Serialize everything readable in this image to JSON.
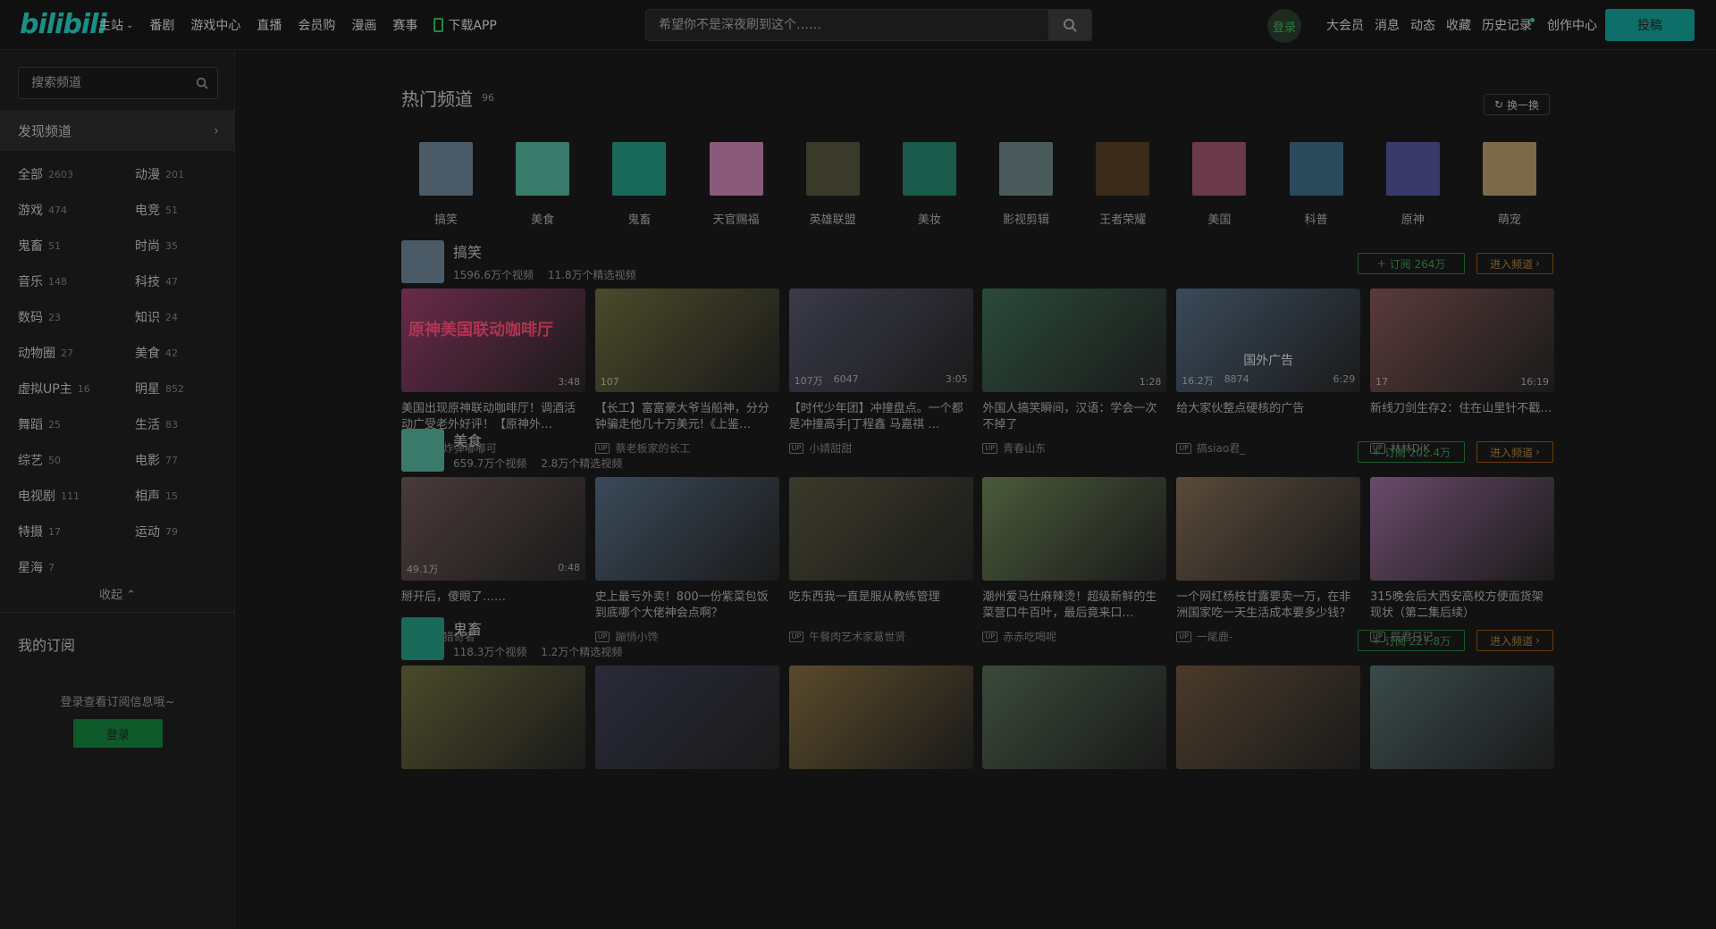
{
  "header": {
    "logo": "bilibili",
    "nav": [
      {
        "label": "主站",
        "chevron": true
      },
      {
        "label": "番剧"
      },
      {
        "label": "游戏中心"
      },
      {
        "label": "直播"
      },
      {
        "label": "会员购"
      },
      {
        "label": "漫画"
      },
      {
        "label": "赛事"
      },
      {
        "label": "下载APP",
        "icon": "phone-icon"
      }
    ],
    "search_placeholder": "希望你不是深夜刷到这个……",
    "login": "登录",
    "right_links": [
      "大会员",
      "消息",
      "动态",
      "收藏",
      "历史记录",
      "创作中心"
    ],
    "upload": "投稿"
  },
  "sidebar": {
    "search_placeholder": "搜索频道",
    "discover": "发现频道",
    "categories": [
      {
        "name": "全部",
        "count": "2603"
      },
      {
        "name": "动漫",
        "count": "201"
      },
      {
        "name": "游戏",
        "count": "474"
      },
      {
        "name": "电竞",
        "count": "51"
      },
      {
        "name": "鬼畜",
        "count": "51"
      },
      {
        "name": "时尚",
        "count": "35"
      },
      {
        "name": "音乐",
        "count": "148"
      },
      {
        "name": "科技",
        "count": "47"
      },
      {
        "name": "数码",
        "count": "23"
      },
      {
        "name": "知识",
        "count": "24"
      },
      {
        "name": "动物圈",
        "count": "27"
      },
      {
        "name": "美食",
        "count": "42"
      },
      {
        "name": "虚拟UP主",
        "count": "16"
      },
      {
        "name": "明星",
        "count": "852"
      },
      {
        "name": "舞蹈",
        "count": "25"
      },
      {
        "name": "生活",
        "count": "83"
      },
      {
        "name": "综艺",
        "count": "50"
      },
      {
        "name": "电影",
        "count": "77"
      },
      {
        "name": "电视剧",
        "count": "111"
      },
      {
        "name": "相声",
        "count": "15"
      },
      {
        "name": "特摄",
        "count": "17"
      },
      {
        "name": "运动",
        "count": "79"
      },
      {
        "name": "星海",
        "count": "7"
      }
    ],
    "collapse": "收起",
    "my_subscriptions": "我的订阅",
    "login_tip": "登录查看订阅信息哦~",
    "login_button": "登录"
  },
  "hot": {
    "title": "热门频道",
    "count": "96",
    "swap": "换一换",
    "channels": [
      {
        "label": "搞笑",
        "color": "#4a5a66"
      },
      {
        "label": "美食",
        "color": "#3a7a6a"
      },
      {
        "label": "鬼畜",
        "color": "#1a6a5a"
      },
      {
        "label": "天官赐福",
        "color": "#8a5a7a"
      },
      {
        "label": "英雄联盟",
        "color": "#3a3a2a"
      },
      {
        "label": "美妆",
        "color": "#1a5a4a"
      },
      {
        "label": "影视剪辑",
        "color": "#4a5a5a"
      },
      {
        "label": "王者荣耀",
        "color": "#3a2a1a"
      },
      {
        "label": "美国",
        "color": "#6a3a4a"
      },
      {
        "label": "科普",
        "color": "#2a4a5a"
      },
      {
        "label": "原神",
        "color": "#3a3a6a"
      },
      {
        "label": "萌宠",
        "color": "#7a6a4a"
      }
    ]
  },
  "sections": [
    {
      "name": "搞笑",
      "avatar_color": "#4a5a66",
      "videos_count": "1596.6万个视频",
      "featured_count": "11.8万个精选视频",
      "subscribe": "订阅 264万",
      "enter": "进入频道",
      "cards": [
        {
          "title": "美国出现原神联动咖啡厅！调酒活动广受老外好评！【原神外…",
          "up": "蹦蹦炸弹嘟嘟可",
          "color": "#6a2a4a",
          "overlay": "原神美国联动咖啡厅",
          "play": "",
          "like": "",
          "dur": "3:48"
        },
        {
          "title": "【长工】富富豪大爷当船神，分分钟骗走他几十万美元!《上鉴…",
          "up": "蔡老板家的长工",
          "color": "#4a4a2a",
          "overlay": "",
          "play": "107",
          "like": "",
          "dur": ""
        },
        {
          "title": "【时代少年团】冲撞盘点。一个都是冲撞高手|丁程鑫 马嘉祺 …",
          "up": "小婧甜甜",
          "color": "#3a3a4a",
          "overlay": "",
          "play": "107万",
          "like": "6047",
          "dur": "3:05"
        },
        {
          "title": "外国人搞笑瞬间，汉语：学会一次不掉了",
          "up": "青春山东",
          "color": "#2a4a3a",
          "overlay": "",
          "play": "",
          "like": "",
          "dur": "1:28"
        },
        {
          "title": "给大家伙整点硬核的广告",
          "up": "搞siao君_",
          "color": "#3a4a5a",
          "overlay": "",
          "overlay2": "国外广告",
          "play": "16.2万",
          "like": "8874",
          "dur": "6:29"
        },
        {
          "title": "新线刀剑生存2：住在山里针不戳…",
          "up": "林林DjK",
          "color": "#5a3a3a",
          "overlay": "",
          "play": "17",
          "like": "",
          "dur": "16:19"
        }
      ]
    },
    {
      "name": "美食",
      "avatar_color": "#3a7a6a",
      "videos_count": "659.7万个视频",
      "featured_count": "2.8万个精选视频",
      "subscribe": "订阅 202.4万",
      "enter": "进入频道",
      "cards": [
        {
          "title": "掰开后，傻眼了……",
          "up": "美好猎奇者",
          "color": "#4a3a3a",
          "overlay": "",
          "play": "49.1万",
          "like": "",
          "dur": "0:48"
        },
        {
          "title": "史上最亏外卖！800一份紫菜包饭到底哪个大佬神会点啊？",
          "up": "蹦悄小馋",
          "color": "#3a4a5a",
          "overlay": "",
          "play": "",
          "like": "",
          "dur": ""
        },
        {
          "title": "吃东西我一直是服从教练管理",
          "up": "午餐肉艺术家葛世贤",
          "color": "#3a3a2a",
          "overlay": "",
          "play": "",
          "like": "",
          "dur": ""
        },
        {
          "title": "潮州爱马仕麻辣烫！超级新鲜的生菜营口牛百叶，最后竟来口…",
          "up": "赤赤吃喝呢",
          "color": "#4a5a3a",
          "overlay": "",
          "play": "",
          "like": "",
          "dur": ""
        },
        {
          "title": "一个网红杨枝甘露要卖一万，在非洲国家吃一天生活成本要多少钱？",
          "up": "一尾鹿-",
          "color": "#5a4a3a",
          "overlay": "",
          "play": "",
          "like": "",
          "dur": ""
        },
        {
          "title": "315晚会后大西安高校方便面货架现状（第二集后续）",
          "up": "辰君日记",
          "color": "#6a4a6a",
          "overlay": "",
          "play": "",
          "like": "",
          "dur": ""
        }
      ]
    },
    {
      "name": "鬼畜",
      "avatar_color": "#1a6a5a",
      "videos_count": "118.3万个视频",
      "featured_count": "1.2万个精选视频",
      "subscribe": "订阅 227.8万",
      "enter": "进入频道",
      "cards": [
        {
          "title": "",
          "up": "",
          "color": "#4a4a2a",
          "overlay": "",
          "play": "",
          "like": "",
          "dur": ""
        },
        {
          "title": "",
          "up": "",
          "color": "#2a2a3a",
          "overlay": "",
          "play": "",
          "like": "",
          "dur": ""
        },
        {
          "title": "",
          "up": "",
          "color": "#5a4a2a",
          "overlay": "",
          "play": "",
          "like": "",
          "dur": ""
        },
        {
          "title": "",
          "up": "",
          "color": "#3a4a3a",
          "overlay": "",
          "play": "",
          "like": "",
          "dur": ""
        },
        {
          "title": "",
          "up": "",
          "color": "#4a3a2a",
          "overlay": "",
          "play": "",
          "like": "",
          "dur": ""
        },
        {
          "title": "",
          "up": "",
          "color": "#3a4a4a",
          "overlay": "",
          "play": "",
          "like": "",
          "dur": ""
        }
      ]
    }
  ]
}
